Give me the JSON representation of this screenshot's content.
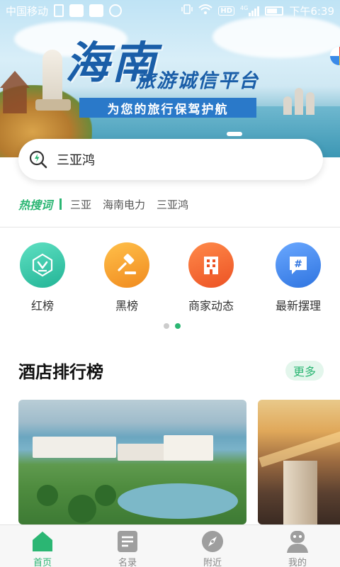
{
  "status_bar": {
    "carrier": "中国移动",
    "time": "下午6:39",
    "network": "4G",
    "hd": "HD"
  },
  "banner": {
    "title": "海南",
    "subtitle": "旅游诚信平台",
    "slogan": "为您的旅行保驾护航"
  },
  "search": {
    "value": "三亚鸿",
    "icon": "search-icon"
  },
  "hot_words": {
    "label": "热搜词",
    "words": [
      "三亚",
      "海南电力",
      "三亚鸿"
    ]
  },
  "categories": [
    {
      "label": "红榜",
      "icon": "medal-icon",
      "color": "#2fc4a8"
    },
    {
      "label": "黑榜",
      "icon": "gavel-icon",
      "color": "#f39a2c"
    },
    {
      "label": "商家动态",
      "icon": "building-icon",
      "color": "#f26a2a"
    },
    {
      "label": "最新摆理",
      "icon": "hashtag-chat-icon",
      "color": "#3d8be8"
    }
  ],
  "pager": {
    "active": 2,
    "total": 2
  },
  "ranking": {
    "title": "酒店排行榜",
    "more": "更多"
  },
  "tabs": [
    {
      "label": "首页",
      "icon": "home-icon",
      "active": true
    },
    {
      "label": "名录",
      "icon": "list-icon",
      "active": false
    },
    {
      "label": "附近",
      "icon": "compass-icon",
      "active": false
    },
    {
      "label": "我的",
      "icon": "profile-icon",
      "active": false
    }
  ],
  "colors": {
    "accent": "#2bb673",
    "banner_blue": "#1a5ea8",
    "inactive": "#9e9e9e"
  }
}
